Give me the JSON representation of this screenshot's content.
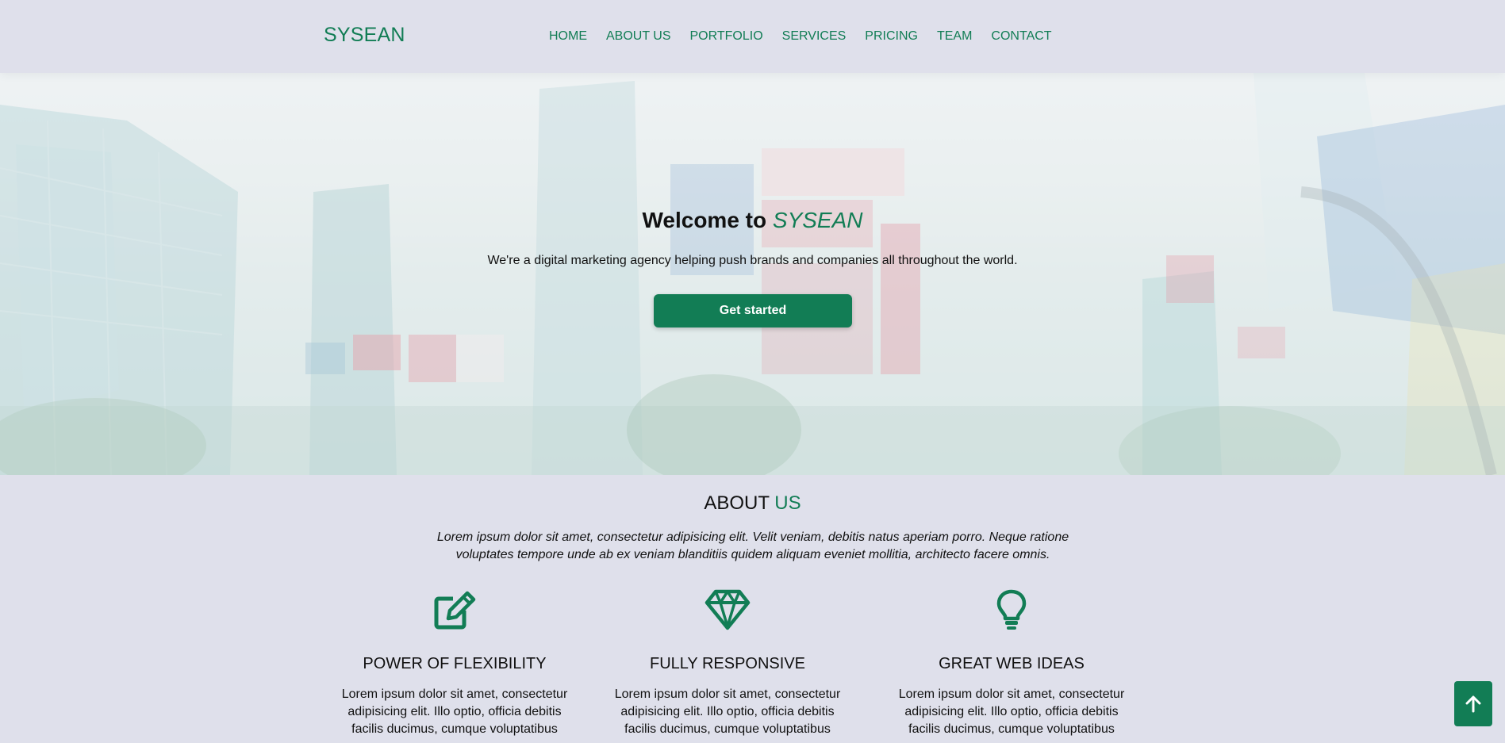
{
  "header": {
    "logo": "SYSEAN",
    "nav": [
      "HOME",
      "ABOUT US",
      "PORTFOLIO",
      "SERVICES",
      "PRICING",
      "TEAM",
      "CONTACT"
    ]
  },
  "hero": {
    "title_prefix": "Welcome to ",
    "title_brand": "SYSEAN",
    "subtitle": "We're a digital marketing agency helping push brands and companies all throughout the world.",
    "cta_label": "Get started"
  },
  "about": {
    "title_main": "ABOUT ",
    "title_accent": "US",
    "text": "Lorem ipsum dolor sit amet, consectetur adipisicing elit. Velit veniam, debitis natus aperiam porro. Neque ratione voluptates tempore unde ab ex veniam blanditiis quidem aliquam eveniet mollitia, architecto facere omnis.",
    "features": [
      {
        "icon": "edit-icon",
        "title": "POWER OF FLEXIBILITY",
        "text": "Lorem ipsum dolor sit amet, consectetur adipisicing elit. Illo optio, officia debitis facilis ducimus, cumque voluptatibus"
      },
      {
        "icon": "diamond-icon",
        "title": "FULLY RESPONSIVE",
        "text": "Lorem ipsum dolor sit amet, consectetur adipisicing elit. Illo optio, officia debitis facilis ducimus, cumque voluptatibus"
      },
      {
        "icon": "lightbulb-icon",
        "title": "GREAT WEB IDEAS",
        "text": "Lorem ipsum dolor sit amet, consectetur adipisicing elit. Illo optio, officia debitis facilis ducimus, cumque voluptatibus"
      }
    ]
  },
  "colors": {
    "accent": "#127d55",
    "background": "#dfe0eb"
  },
  "back_to_top": {
    "icon": "arrow-up-icon"
  }
}
